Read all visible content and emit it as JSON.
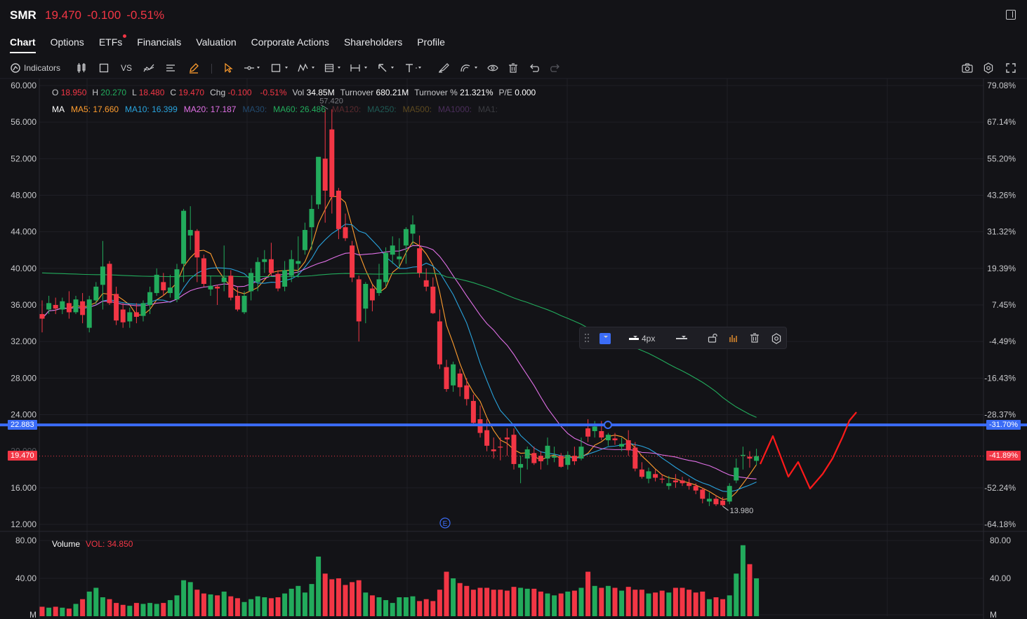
{
  "header": {
    "ticker": "SMR",
    "price": "19.470",
    "change": "-0.100",
    "change_pct": "-0.51%"
  },
  "tabs": [
    {
      "label": "Chart",
      "active": true
    },
    {
      "label": "Options"
    },
    {
      "label": "ETFs",
      "dot": true
    },
    {
      "label": "Financials"
    },
    {
      "label": "Valuation"
    },
    {
      "label": "Corporate Actions"
    },
    {
      "label": "Shareholders"
    },
    {
      "label": "Profile"
    }
  ],
  "toolbar": {
    "indicators_label": "Indicators",
    "vs_label": "VS"
  },
  "ohlc": {
    "o_label": "O",
    "o": "18.950",
    "h_label": "H",
    "h": "20.270",
    "l_label": "L",
    "l": "18.480",
    "c_label": "C",
    "c": "19.470",
    "chg_label": "Chg",
    "chg": "-0.100",
    "chg_pct": "-0.51%",
    "vol_label": "Vol",
    "vol": "34.85M",
    "turnover_label": "Turnover",
    "turnover": "680.21M",
    "turnover_pct_label": "Turnover %",
    "turnover_pct": "21.321%",
    "pe_label": "P/E",
    "pe": "0.000"
  },
  "ma_legend": {
    "label": "MA",
    "ma5": "MA5: 17.660",
    "ma10": "MA10: 16.399",
    "ma20": "MA20: 17.187",
    "ma30": "MA30:",
    "ma60": "MA60: 26.486",
    "ma120": "MA120:",
    "ma250": "MA250:",
    "ma500": "MA500:",
    "ma1000": "MA1000:",
    "ma1": "MA1:"
  },
  "colors": {
    "up": "#22ab5c",
    "down": "#f23645",
    "ma5": "#ff9d2e",
    "ma10": "#29a3dd",
    "ma20": "#e070e6",
    "ma60": "#22ab5c",
    "hline": "#3b6cf6",
    "drawing": "#ff1a1a"
  },
  "y_axis_left": [
    "60.000",
    "56.000",
    "52.000",
    "48.000",
    "44.000",
    "40.000",
    "36.000",
    "32.000",
    "28.000",
    "24.000",
    "16.000",
    "12.000"
  ],
  "y_axis_right": [
    "79.08%",
    "67.14%",
    "55.20%",
    "43.26%",
    "31.32%",
    "19.39%",
    "7.45%",
    "-4.49%",
    "-16.43%",
    "-28.37%",
    "-52.24%",
    "-64.18%"
  ],
  "hline_price": "22.883",
  "hline_pct": "-31.70%",
  "last_price": "19.470",
  "last_pct": "-41.89%",
  "high_marker": "57.420",
  "low_marker": "13.980",
  "event_marker": "E",
  "volume": {
    "label": "Volume",
    "vol": "VOL: 34.850",
    "axis_left": [
      "80.00",
      "40.00",
      "M"
    ],
    "axis_right": [
      "80.00",
      "40.00",
      "M"
    ]
  },
  "float_toolbar": {
    "width_label": "4px"
  },
  "chart_data": {
    "type": "candlestick",
    "y_range": [
      12,
      60
    ],
    "volume_range": [
      0,
      80
    ],
    "candles": [
      [
        35,
        36.5,
        33,
        34.5
      ],
      [
        35.5,
        37,
        35,
        36.2
      ],
      [
        36,
        36.8,
        35,
        35.6
      ],
      [
        35.5,
        36.8,
        35,
        36.4
      ],
      [
        36.2,
        37.5,
        34.5,
        35.2
      ],
      [
        35.2,
        37,
        35,
        36.6
      ],
      [
        36.4,
        37.3,
        34,
        34.9
      ],
      [
        33.5,
        37,
        33,
        36.6
      ],
      [
        36.5,
        38.5,
        36,
        38
      ],
      [
        38.2,
        43,
        35.5,
        40.2
      ],
      [
        40.5,
        40.8,
        36,
        36.2
      ],
      [
        37.2,
        38,
        33.8,
        34.3
      ],
      [
        35.5,
        36.2,
        33.5,
        34.1
      ],
      [
        34.2,
        35.7,
        33.5,
        35.2
      ],
      [
        35.2,
        36.2,
        34,
        34.7
      ],
      [
        34.8,
        36.5,
        34.2,
        36.2
      ],
      [
        36,
        38,
        35,
        37.4
      ],
      [
        37.3,
        40,
        37,
        39.3
      ],
      [
        38.5,
        39.5,
        37,
        37.6
      ],
      [
        37.3,
        39.3,
        36.8,
        37.9
      ],
      [
        36.6,
        40.5,
        36.3,
        39.9
      ],
      [
        40.5,
        46.5,
        38.5,
        46.3
      ],
      [
        43.6,
        46.8,
        42,
        44.2
      ],
      [
        44.1,
        44.3,
        38.5,
        41.2
      ],
      [
        41.1,
        41.5,
        38,
        38.3
      ],
      [
        37.7,
        39.2,
        37,
        38.1
      ],
      [
        38,
        38.2,
        36,
        37.8
      ],
      [
        38.5,
        42.5,
        37.5,
        39
      ],
      [
        39.2,
        39.8,
        36.5,
        36.8
      ],
      [
        37,
        38,
        35.3,
        35.5
      ],
      [
        35.2,
        37.5,
        35,
        37
      ],
      [
        37.5,
        40,
        36.5,
        39.5
      ],
      [
        38.5,
        41.2,
        37.5,
        40.7
      ],
      [
        40.7,
        42,
        39.5,
        41
      ],
      [
        41,
        42.8,
        39.2,
        39.5
      ],
      [
        39.4,
        39.8,
        37.5,
        37.8
      ],
      [
        38,
        40.8,
        37.5,
        39.8
      ],
      [
        39.2,
        42,
        38.5,
        41
      ],
      [
        40.5,
        43.5,
        39,
        40.8
      ],
      [
        42,
        45,
        41.5,
        44.2
      ],
      [
        44.5,
        48,
        42,
        46.5
      ],
      [
        47,
        52,
        46.5,
        52.2
      ],
      [
        52,
        57.4,
        45,
        48.5
      ],
      [
        55.2,
        57.4,
        46,
        47.8
      ],
      [
        48.5,
        48.8,
        43.2,
        44.3
      ],
      [
        44.5,
        46,
        43,
        43.3
      ],
      [
        42.5,
        43,
        38.5,
        39
      ],
      [
        38.8,
        39.2,
        32,
        34.2
      ],
      [
        35.6,
        38.5,
        34,
        38.3
      ],
      [
        37.8,
        38.2,
        35.3,
        36.5
      ],
      [
        37.3,
        40.5,
        37,
        38.8
      ],
      [
        38.5,
        42.3,
        38,
        41.7
      ],
      [
        41.5,
        43.5,
        40.5,
        42.5
      ],
      [
        41,
        43.3,
        40,
        41.3
      ],
      [
        42.5,
        44.5,
        40.5,
        44.3
      ],
      [
        43.8,
        45.8,
        42.5,
        44.8
      ],
      [
        42.2,
        43.6,
        39,
        39.5
      ],
      [
        38.7,
        40,
        37.5,
        38
      ],
      [
        38,
        39,
        35,
        35.1
      ],
      [
        34.2,
        35.5,
        29,
        29.5
      ],
      [
        29.2,
        30,
        26.5,
        26.8
      ],
      [
        27.2,
        29.8,
        26.5,
        29.5
      ],
      [
        28.5,
        29,
        26,
        27
      ],
      [
        27.2,
        28,
        25,
        25.7
      ],
      [
        25.5,
        26.2,
        23,
        23.1
      ],
      [
        23.5,
        25,
        21.5,
        22
      ],
      [
        22.3,
        23.5,
        20,
        20.6
      ],
      [
        20.2,
        21.5,
        19.2,
        20
      ],
      [
        20.5,
        21.5,
        19,
        20.4
      ],
      [
        21.5,
        22.5,
        19.5,
        21.3
      ],
      [
        21.8,
        22.5,
        18,
        18.6
      ],
      [
        18.2,
        19.5,
        16.5,
        18.6
      ],
      [
        19.2,
        20.5,
        18,
        20.2
      ],
      [
        19.8,
        20.5,
        18.5,
        18.7
      ],
      [
        19.5,
        20,
        18,
        18.9
      ],
      [
        19.2,
        21.5,
        18.5,
        20.6
      ],
      [
        19.3,
        20.5,
        18.8,
        19.5
      ],
      [
        19.5,
        19.8,
        18.2,
        18.3
      ],
      [
        18.5,
        20,
        18,
        19.6
      ],
      [
        19.5,
        20.5,
        18.5,
        18.9
      ],
      [
        19.2,
        21.5,
        19,
        20.5
      ],
      [
        22.5,
        23.5,
        21,
        21.6
      ],
      [
        22.2,
        23.3,
        21.5,
        22.7
      ],
      [
        22.2,
        23.3,
        21.2,
        21.5
      ],
      [
        21.2,
        22,
        20.6,
        21.8
      ],
      [
        21.4,
        22,
        20.7,
        21.2
      ],
      [
        20.5,
        21.5,
        20,
        20.8
      ],
      [
        21.2,
        22.3,
        19.5,
        20.1
      ],
      [
        20.4,
        21,
        17.8,
        18.1
      ],
      [
        18,
        18.8,
        17,
        17.2
      ],
      [
        17,
        18.2,
        16.5,
        17.8
      ],
      [
        17.5,
        18,
        16.7,
        17.1
      ],
      [
        17,
        17.5,
        16.5,
        16.9
      ],
      [
        16.2,
        17.3,
        15.8,
        16.5
      ],
      [
        16.8,
        17.5,
        16,
        16.6
      ],
      [
        16.8,
        17.2,
        16.2,
        16.5
      ],
      [
        16.5,
        17,
        15.8,
        16.2
      ],
      [
        16.2,
        16.5,
        15.3,
        15.7
      ],
      [
        15.8,
        16,
        14.3,
        14.8
      ],
      [
        14.5,
        15.5,
        14,
        14.8
      ],
      [
        14.8,
        15.2,
        14,
        14.2
      ],
      [
        14.6,
        15,
        13.98,
        14.1
      ],
      [
        14.5,
        16.5,
        14.2,
        16.2
      ],
      [
        16.8,
        19.2,
        16.5,
        18.2
      ],
      [
        19.5,
        20.5,
        18,
        19.6
      ],
      [
        19.4,
        20,
        18.2,
        19.2
      ],
      [
        18.95,
        20.27,
        18.48,
        19.47
      ]
    ],
    "volumes": [
      10,
      9,
      10,
      9,
      8,
      13,
      18,
      26,
      30,
      20,
      18,
      14,
      12,
      11,
      14,
      13,
      14,
      13,
      14,
      17,
      22,
      38,
      36,
      28,
      24,
      23,
      22,
      26,
      21,
      19,
      15,
      18,
      21,
      20,
      19,
      20,
      24,
      29,
      32,
      25,
      34,
      63,
      45,
      39,
      40,
      33,
      36,
      38,
      25,
      22,
      20,
      17,
      14,
      20,
      20,
      21,
      16,
      18,
      16,
      28,
      47,
      40,
      35,
      32,
      28,
      30,
      30,
      28,
      28,
      27,
      31,
      30,
      29,
      29,
      26,
      24,
      22,
      24,
      26,
      27,
      30,
      47,
      32,
      30,
      32,
      30,
      27,
      31,
      28,
      28,
      24,
      25,
      27,
      25,
      30,
      30,
      28,
      25,
      26,
      18,
      20,
      18,
      22,
      45,
      75,
      55,
      40
    ]
  }
}
